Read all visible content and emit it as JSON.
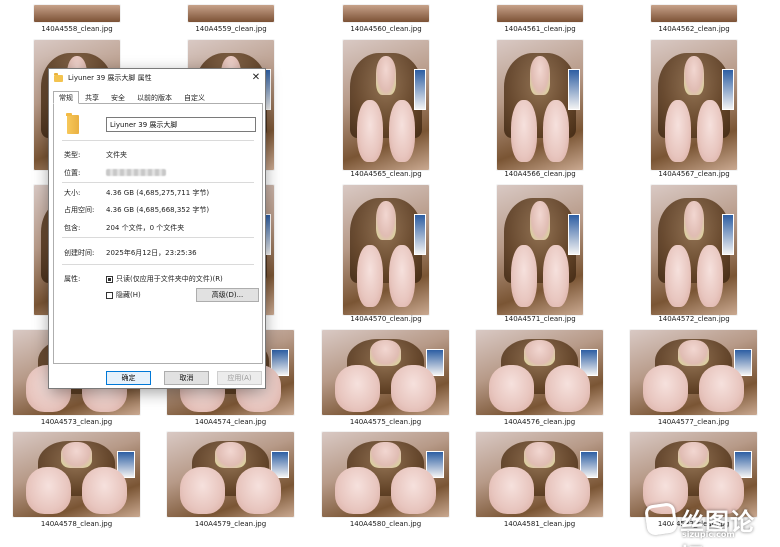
{
  "explorer": {
    "files": [
      "140A4558_clean.jpg",
      "140A4559_clean.jpg",
      "140A4560_clean.jpg",
      "140A4561_clean.jpg",
      "140A4562_clean.jpg",
      "140A4565_clean.jpg",
      "140A4566_clean.jpg",
      "140A4567_clean.jpg",
      "140A4570_clean.jpg",
      "140A4571_clean.jpg",
      "140A4572_clean.jpg",
      "140A4573_clean.jpg",
      "140A4574_clean.jpg",
      "140A4575_clean.jpg",
      "140A4576_clean.jpg",
      "140A4577_clean.jpg",
      "140A4578_clean.jpg",
      "140A4579_clean.jpg",
      "140A4580_clean.jpg",
      "140A4581_clean.jpg",
      "140A4582_clean.jpg"
    ]
  },
  "dialog": {
    "title": "Liyuner 39 展示大脚 属性",
    "tabs": [
      "常规",
      "共享",
      "安全",
      "以前的版本",
      "自定义"
    ],
    "active_tab": "常规",
    "folder_name": "Liyuner 39 展示大脚",
    "props": {
      "type_label": "类型:",
      "type_value": "文件夹",
      "location_label": "位置:",
      "size_label": "大小:",
      "size_value": "4.36 GB (4,685,275,711 字节)",
      "disk_label": "占用空间:",
      "disk_value": "4.36 GB (4,685,668,352 字节)",
      "contains_label": "包含:",
      "contains_value": "204 个文件，0 个文件夹",
      "created_label": "创建时间:",
      "created_value": "2025年6月12日，23:25:36",
      "attrs_label": "属性:",
      "readonly_label": "只读(仅应用于文件夹中的文件)(R)",
      "hidden_label": "隐藏(H)",
      "advanced_label": "高级(D)..."
    },
    "buttons": {
      "ok": "确定",
      "cancel": "取消",
      "apply": "应用(A)"
    },
    "icons": {
      "close": "close-icon",
      "folder": "folder-icon"
    }
  },
  "watermark": {
    "text": "丝图论坛",
    "url": "sizupic.com"
  }
}
